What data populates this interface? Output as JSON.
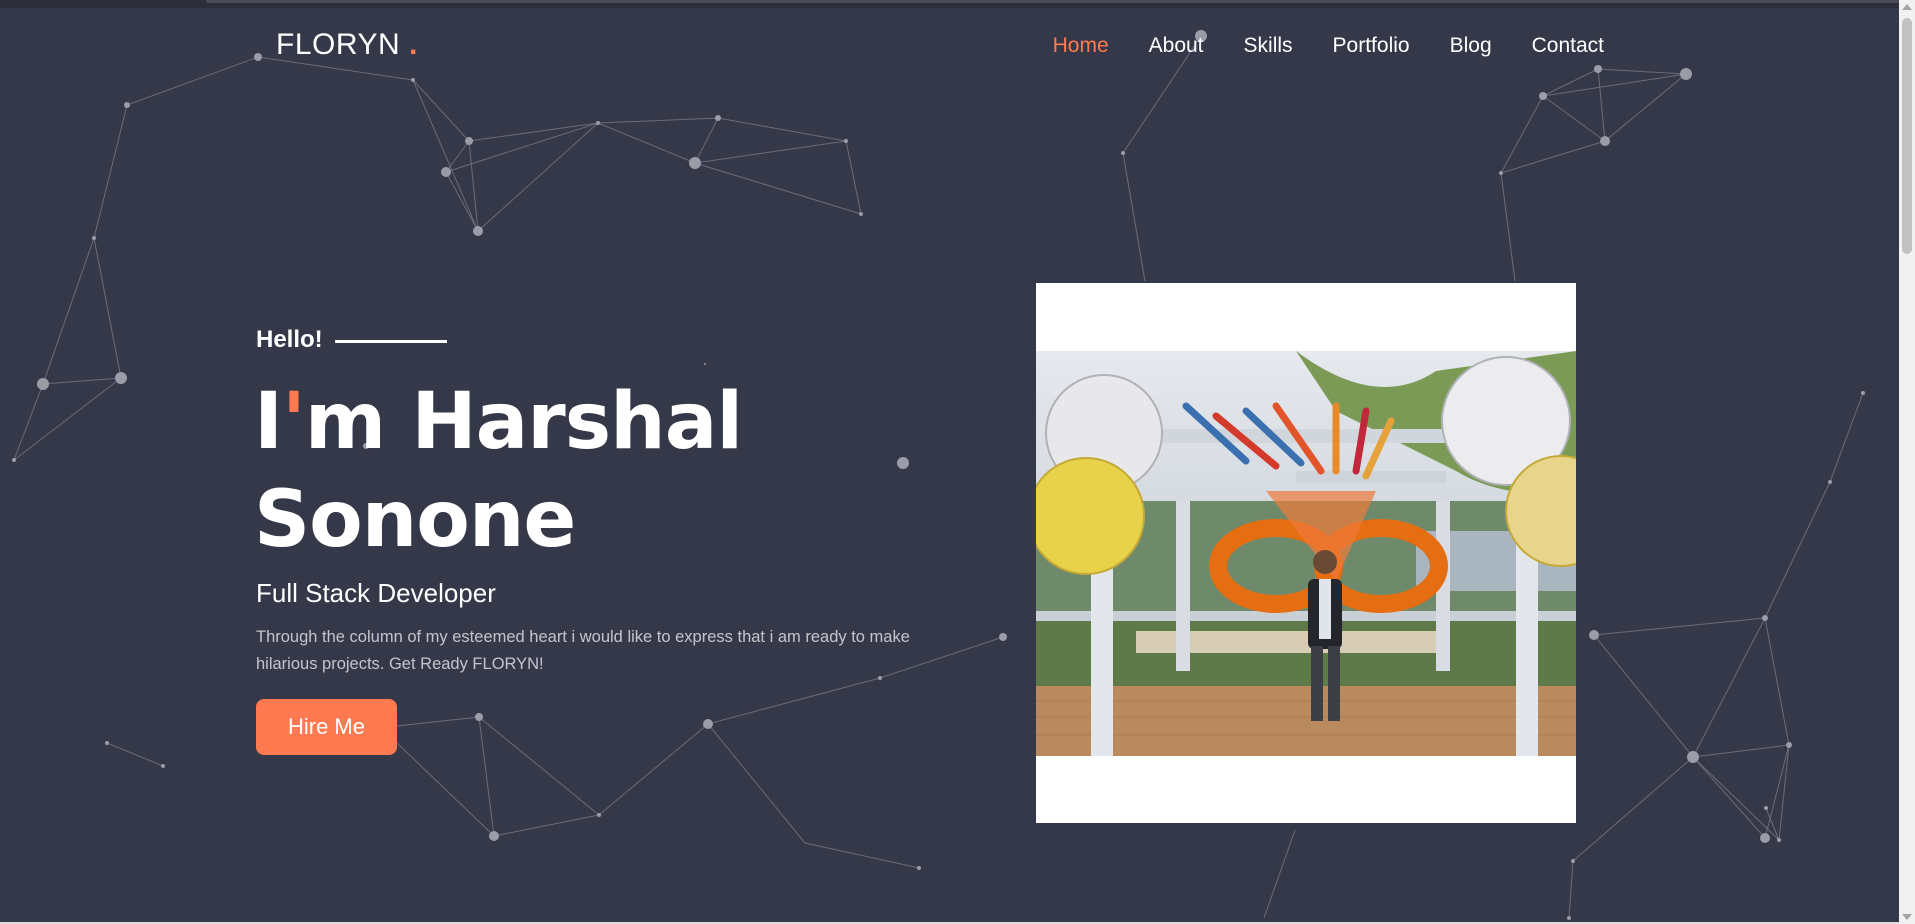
{
  "brand": {
    "name": "FLORYN",
    "dot": "."
  },
  "nav": {
    "items": [
      {
        "label": "Home",
        "active": true
      },
      {
        "label": "About"
      },
      {
        "label": "Skills"
      },
      {
        "label": "Portfolio"
      },
      {
        "label": "Blog"
      },
      {
        "label": "Contact"
      }
    ]
  },
  "hero": {
    "greeting": "Hello!",
    "name_line1_first": "I",
    "name_line1_apostrophe": "'",
    "name_line1_rest": "m Harshal",
    "name_line2": "Sonone",
    "role": "Full Stack Developer",
    "description": "Through the column of my esteemed heart i would like to express that i am ready to make hilarious projects. Get Ready FLORYN!",
    "cta_label": "Hire Me"
  },
  "colors": {
    "accent": "#ff7a50",
    "background": "#353848",
    "text": "#ffffff",
    "muted": "#c4c5cc"
  },
  "icons": {
    "scroll_up": "chevron-up-icon",
    "scroll_down": "chevron-down-icon"
  }
}
